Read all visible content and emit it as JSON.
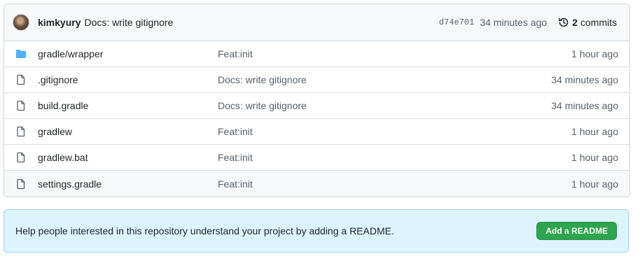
{
  "commit": {
    "author": "kimkyury",
    "message": "Docs: write gitignore",
    "sha": "d74e701",
    "time": "34 minutes ago",
    "commit_count": "2",
    "commits_label": "commits"
  },
  "files": [
    {
      "name_dir": "gradle/",
      "name": "wrapper",
      "type": "folder",
      "message": "Feat:init",
      "age": "1 hour ago"
    },
    {
      "name_dir": "",
      "name": ".gitignore",
      "type": "file",
      "message": "Docs: write gitignore",
      "age": "34 minutes ago"
    },
    {
      "name_dir": "",
      "name": "build.gradle",
      "type": "file",
      "message": "Docs: write gitignore",
      "age": "34 minutes ago"
    },
    {
      "name_dir": "",
      "name": "gradlew",
      "type": "file",
      "message": "Feat:init",
      "age": "1 hour ago"
    },
    {
      "name_dir": "",
      "name": "gradlew.bat",
      "type": "file",
      "message": "Feat:init",
      "age": "1 hour ago"
    },
    {
      "name_dir": "",
      "name": "settings.gradle",
      "type": "file",
      "message": "Feat:init",
      "age": "1 hour ago"
    }
  ],
  "readme_banner": {
    "text": "Help people interested in this repository understand your project by adding a README.",
    "button_label": "Add a README"
  },
  "colors": {
    "folder_icon": "#54aeff",
    "file_icon": "#57606a",
    "button_bg": "#2da44e",
    "banner_bg": "#ddf4ff"
  }
}
